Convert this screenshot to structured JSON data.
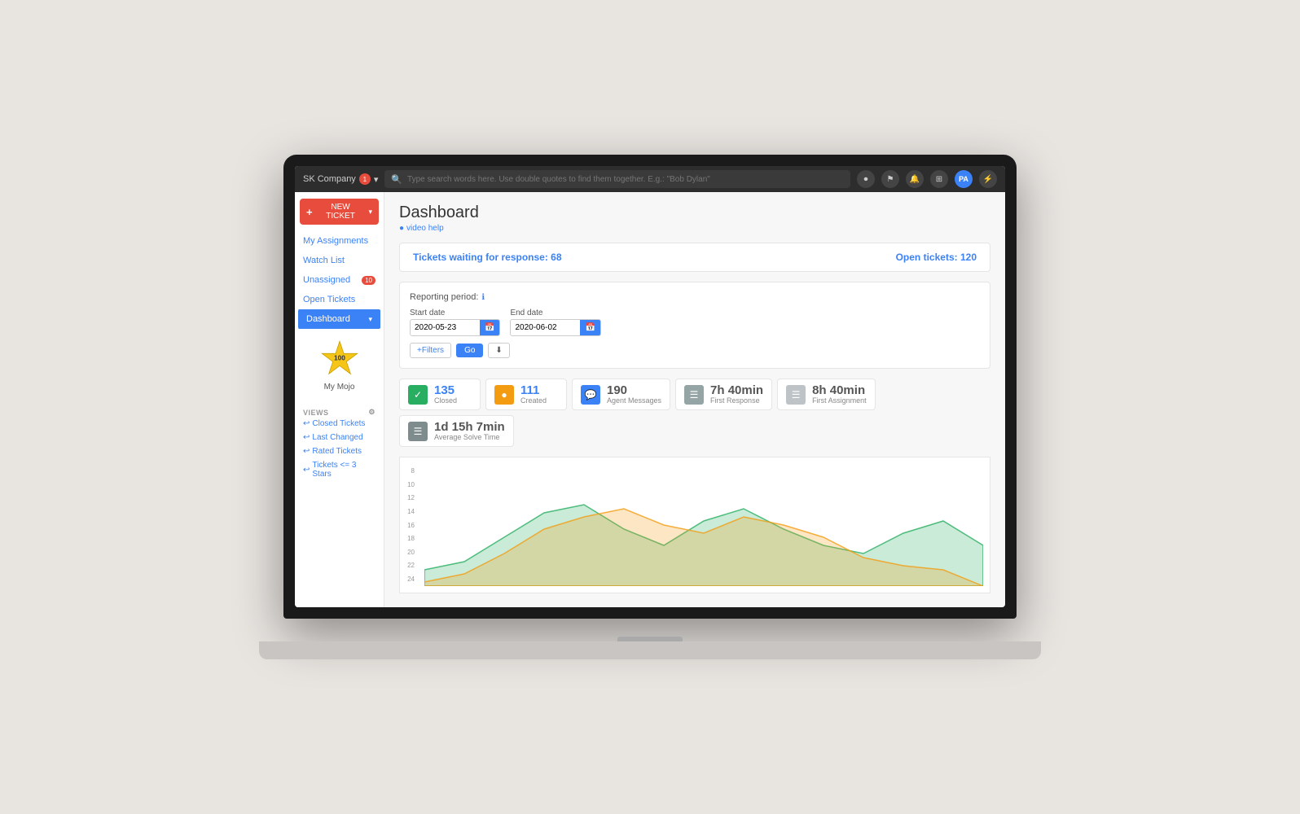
{
  "topbar": {
    "company": "SK Company",
    "company_badge": "1",
    "search_placeholder": "Type search words here. Use double quotes to find them together. E.g.: \"Bob Dylan\"",
    "avatar": "PA"
  },
  "sidebar": {
    "new_ticket_label": "NEW TICKET",
    "nav_items": [
      {
        "label": "My Assignments",
        "active": false,
        "badge": null
      },
      {
        "label": "Watch List",
        "active": false,
        "badge": null
      },
      {
        "label": "Unassigned",
        "active": false,
        "badge": "10"
      },
      {
        "label": "Open Tickets",
        "active": false,
        "badge": null
      },
      {
        "label": "Dashboard",
        "active": true,
        "badge": null
      }
    ],
    "mojo_label": "My Mojo",
    "mojo_score": "100",
    "views_title": "VIEWS",
    "views_items": [
      {
        "label": "Closed Tickets"
      },
      {
        "label": "Last Changed"
      },
      {
        "label": "Rated Tickets"
      },
      {
        "label": "Tickets <= 3 Stars"
      }
    ]
  },
  "dashboard": {
    "title": "Dashboard",
    "video_help": "video help",
    "waiting_label": "Tickets waiting for response:",
    "waiting_count": "68",
    "open_label": "Open tickets:",
    "open_count": "120",
    "reporting_period_label": "Reporting period:",
    "start_date_label": "Start date",
    "start_date_value": "2020-05-23",
    "end_date_label": "End date",
    "end_date_value": "2020-06-02",
    "filters_label": "+Filters",
    "go_label": "Go",
    "download_label": "⬇"
  },
  "metrics": [
    {
      "icon": "✓",
      "icon_class": "green",
      "value": "135",
      "value_class": "",
      "label": "Closed"
    },
    {
      "icon": "●",
      "icon_class": "orange",
      "value": "111",
      "value_class": "",
      "label": "Created"
    },
    {
      "icon": "💬",
      "icon_class": "blue",
      "value": "190",
      "value_class": "dark",
      "label": "Agent Messages"
    },
    {
      "icon": "☰",
      "icon_class": "gray",
      "value": "7h 40min",
      "value_class": "dark",
      "label": "First Response"
    },
    {
      "icon": "☰",
      "icon_class": "lightgray",
      "value": "8h 40min",
      "value_class": "dark",
      "label": "First Assignment"
    },
    {
      "icon": "☰",
      "icon_class": "darkgray",
      "value": "1d 15h 7min",
      "value_class": "dark",
      "label": "Average Solve Time"
    }
  ],
  "chart": {
    "y_labels": [
      "8",
      "10",
      "12",
      "14",
      "16",
      "18",
      "20",
      "22",
      "24"
    ]
  }
}
